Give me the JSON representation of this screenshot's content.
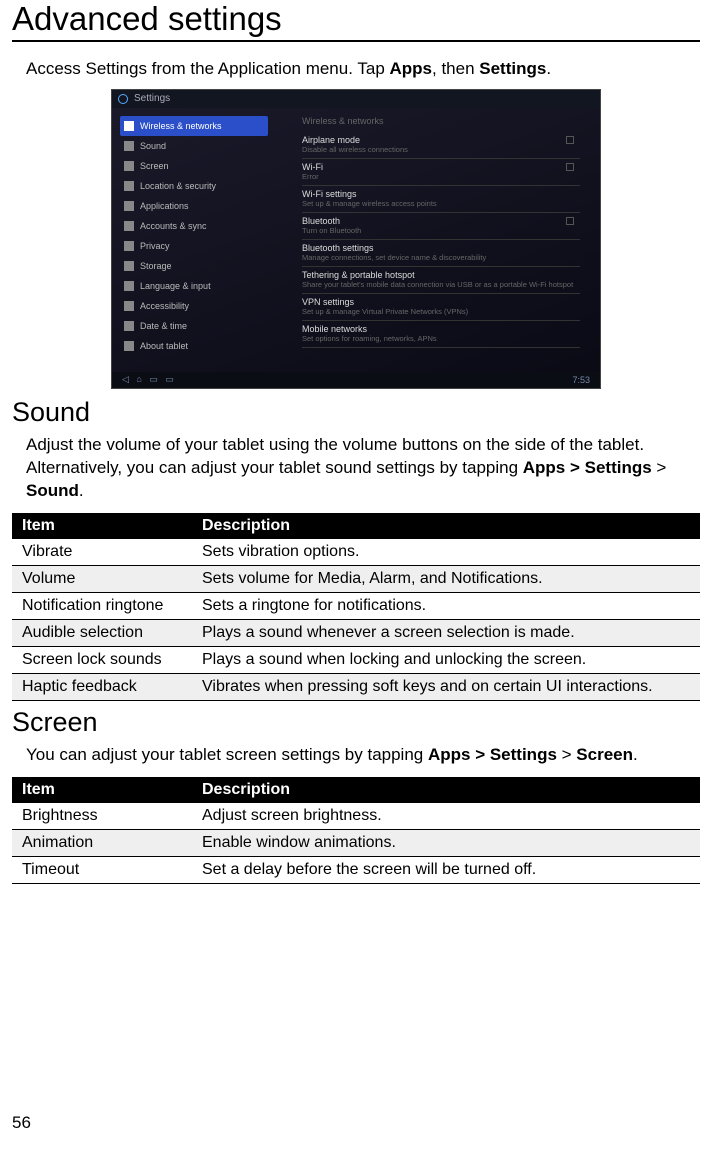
{
  "page": {
    "title": "Advanced settings",
    "number": "56"
  },
  "intro": {
    "pre": "Access Settings from the Application menu. Tap ",
    "b1": "Apps",
    "mid": ", then ",
    "b2": "Settings",
    "post": "."
  },
  "screenshot": {
    "header": "Settings",
    "left_items": [
      "Wireless & networks",
      "Sound",
      "Screen",
      "Location & security",
      "Applications",
      "Accounts & sync",
      "Privacy",
      "Storage",
      "Language & input",
      "Accessibility",
      "Date & time",
      "About tablet"
    ],
    "right_header": "Wireless & networks",
    "right_rows": [
      {
        "t": "Airplane mode",
        "s": "Disable all wireless connections",
        "chk": true
      },
      {
        "t": "Wi-Fi",
        "s": "Error",
        "chk": true
      },
      {
        "t": "Wi-Fi settings",
        "s": "Set up & manage wireless access points"
      },
      {
        "t": "Bluetooth",
        "s": "Turn on Bluetooth",
        "chk": true
      },
      {
        "t": "Bluetooth settings",
        "s": "Manage connections, set device name & discoverability"
      },
      {
        "t": "Tethering & portable hotspot",
        "s": "Share your tablet's mobile data connection via USB or as a portable Wi-Fi hotspot"
      },
      {
        "t": "VPN settings",
        "s": "Set up & manage Virtual Private Networks (VPNs)"
      },
      {
        "t": "Mobile networks",
        "s": "Set options for roaming, networks, APNs"
      }
    ],
    "time": "7:53"
  },
  "sound": {
    "heading": "Sound",
    "text_pre": "Adjust the volume of your tablet using the volume buttons on the side of the tablet. Alternatively, you can adjust your tablet sound settings by tapping ",
    "b1": "Apps > Settings",
    "mid": " > ",
    "b2": "Sound",
    "post": ".",
    "th_item": "Item",
    "th_desc": "Description",
    "rows": [
      {
        "item": "Vibrate",
        "desc": "Sets vibration options."
      },
      {
        "item": "Volume",
        "desc": "Sets volume for Media, Alarm, and Notifications."
      },
      {
        "item": "Notification ringtone",
        "desc": "Sets a ringtone for notifications."
      },
      {
        "item": "Audible selection",
        "desc": "Plays a sound whenever a screen selection is made."
      },
      {
        "item": "Screen lock sounds",
        "desc": "Plays a sound when locking and unlocking the screen."
      },
      {
        "item": "Haptic feedback",
        "desc": "Vibrates when pressing soft keys and on certain UI interactions."
      }
    ]
  },
  "screen": {
    "heading": "Screen",
    "text_pre": "You can adjust your tablet screen settings by tapping ",
    "b1": "Apps > Settings",
    "mid": " > ",
    "b2": "Screen",
    "post": ".",
    "th_item": "Item",
    "th_desc": "Description",
    "rows": [
      {
        "item": "Brightness",
        "desc": "Adjust screen brightness."
      },
      {
        "item": "Animation",
        "desc": "Enable window animations."
      },
      {
        "item": "Timeout",
        "desc": "Set a delay before the screen will be turned off."
      }
    ]
  }
}
